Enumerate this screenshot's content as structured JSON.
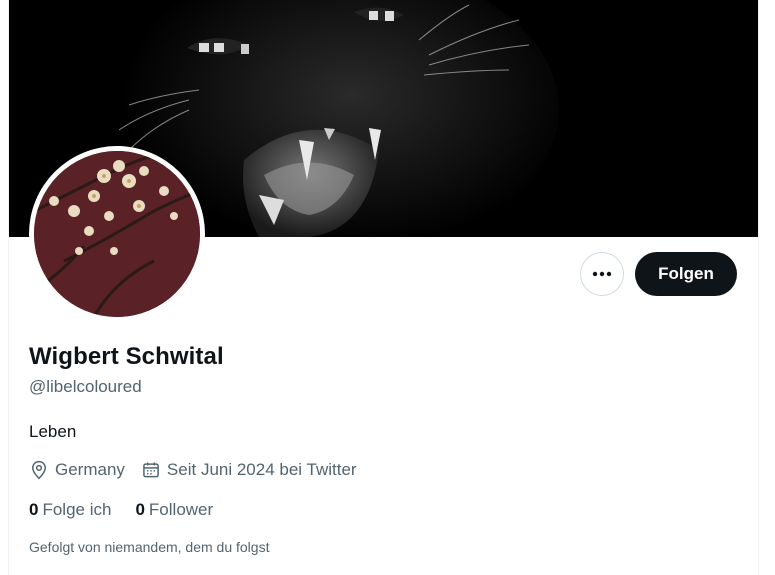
{
  "profile": {
    "name": "Wigbert Schwital",
    "handle": "@libelcoloured",
    "bio": "Leben",
    "location": "Germany",
    "joined": "Seit Juni 2024 bei Twitter"
  },
  "actions": {
    "follow_label": "Folgen",
    "more_icon": "more-dots-icon"
  },
  "stats": {
    "following_count": "0",
    "following_label": "Folge ich",
    "followers_count": "0",
    "followers_label": "Follower"
  },
  "followed_by": "Gefolgt von niemandem, dem du folgst",
  "colors": {
    "primary_text": "#0f1419",
    "secondary_text": "#536471",
    "follow_button_bg": "#0f1419",
    "banner_bg": "#000000",
    "avatar_bg": "#5a2226"
  }
}
